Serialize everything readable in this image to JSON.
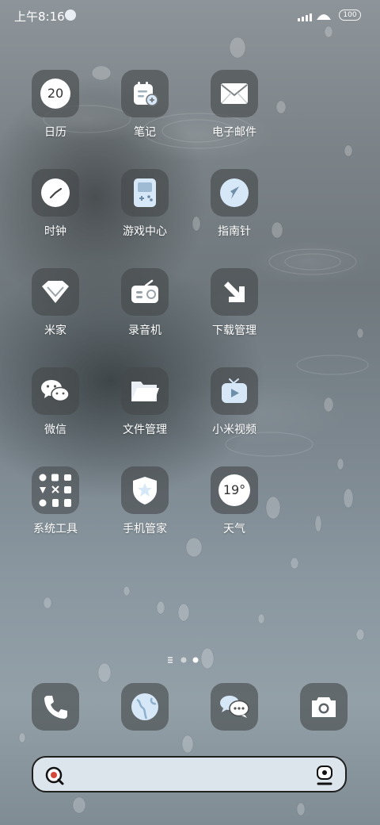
{
  "status_bar": {
    "time": "上午8:16",
    "battery": "100"
  },
  "apps": [
    {
      "label": "日历",
      "icon": "calendar-icon",
      "badge": "20"
    },
    {
      "label": "笔记",
      "icon": "notes-icon"
    },
    {
      "label": "电子邮件",
      "icon": "mail-icon"
    },
    {
      "label": "时钟",
      "icon": "clock-icon"
    },
    {
      "label": "游戏中心",
      "icon": "gamepad-icon"
    },
    {
      "label": "指南针",
      "icon": "compass-icon"
    },
    {
      "label": "米家",
      "icon": "mijia-icon"
    },
    {
      "label": "录音机",
      "icon": "recorder-icon"
    },
    {
      "label": "下载管理",
      "icon": "download-icon"
    },
    {
      "label": "微信",
      "icon": "wechat-icon"
    },
    {
      "label": "文件管理",
      "icon": "folder-icon"
    },
    {
      "label": "小米视频",
      "icon": "video-icon"
    },
    {
      "label": "系统工具",
      "icon": "system-tools-folder-icon"
    },
    {
      "label": "手机管家",
      "icon": "security-shield-icon"
    },
    {
      "label": "天气",
      "icon": "weather-icon",
      "badge": "19°"
    }
  ],
  "dock": [
    {
      "icon": "phone-icon"
    },
    {
      "icon": "browser-icon"
    },
    {
      "icon": "messages-icon"
    },
    {
      "icon": "camera-icon"
    }
  ],
  "colors": {
    "tile": "#46484a",
    "icon_white": "#ffffff",
    "icon_blue": "#d6e7f7",
    "search_bg": "#dce5ec"
  }
}
